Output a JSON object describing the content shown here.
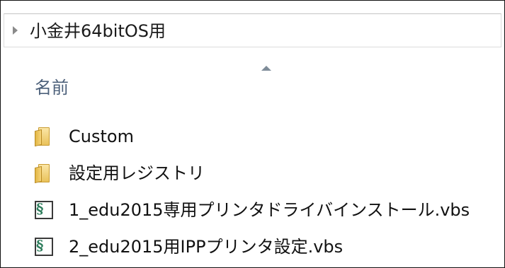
{
  "breadcrumb": {
    "path": "小金井64bitOS用"
  },
  "column_header": {
    "name": "名前"
  },
  "files": [
    {
      "name": "Custom",
      "type": "folder"
    },
    {
      "name": "設定用レジストリ",
      "type": "folder"
    },
    {
      "name": "1_edu2015専用プリンタドライバインストール.vbs",
      "type": "vbs"
    },
    {
      "name": "2_edu2015用IPPプリンタ設定.vbs",
      "type": "vbs"
    }
  ],
  "colors": {
    "header_text": "#4c607a",
    "folder_yellow": "#e9c25b",
    "script_green": "#2e7d5c"
  },
  "icons": {
    "folder": "folder-icon",
    "vbs": "vbs-script-icon",
    "expand": "chevron-right-icon",
    "sort": "sort-ascending-icon"
  }
}
